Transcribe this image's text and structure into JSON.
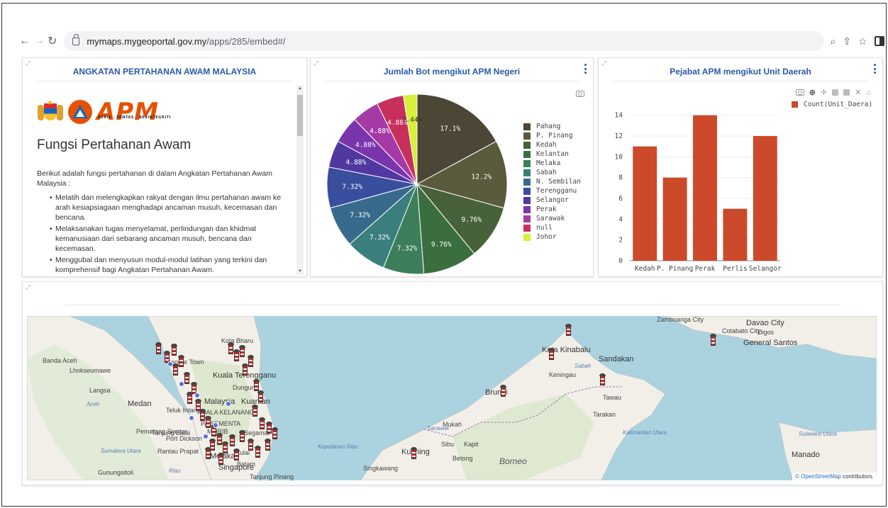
{
  "browser": {
    "url_host": "mymaps.mygeoportal.gov.my",
    "url_path": "/apps/285/embed#/"
  },
  "text_panel": {
    "title": "ANGKATAN PERTAHANAN AWAM MALAYSIA",
    "logo_word": "APM",
    "logo_tagline": "BERIA . PANTAS . BERINTEGRITI",
    "heading": "Fungsi Pertahanan Awam",
    "intro": "Berikut adalah fungsi pertahanan di dalam Angkatan Pertahanan Awam Malaysia :",
    "bullets": [
      "Melatih dan melengkapkan rakyat dengan ilmu pertahanan awam ke arah kesiapsiagaan menghadapi ancaman musuh, kecemasan dan bencana.",
      "Melaksanakan tugas menyelamat, perlindungan dan khidmat kemanusiaan dari sebarang ancaman musuh, bencana dan kecemasan.",
      "Menggubal dan menyusun modul-modul latihan yang terkini dan komprehensif bagi Angkatan Pertahanan Awam."
    ]
  },
  "pie_panel": {
    "title": "Jumlah Bot mengikut APM Negeri"
  },
  "bar_panel": {
    "title": "Pejabat APM mengikut Unit Daerah"
  },
  "map_panel": {
    "attribution_link": "© OpenStreetMap",
    "attribution_rest": " contributors.",
    "labels": [
      {
        "t": "Banda Aceh",
        "c": ""
      },
      {
        "t": "Lhokseumawe",
        "c": ""
      },
      {
        "t": "Langsa",
        "c": ""
      },
      {
        "t": "Medan",
        "c": "big"
      },
      {
        "t": "Pematang Siantar",
        "c": ""
      },
      {
        "t": "Rantau Prapat",
        "c": ""
      },
      {
        "t": "Gunungsitoli",
        "c": ""
      },
      {
        "t": "Kuala Terengganu",
        "c": "big"
      },
      {
        "t": "Dungun",
        "c": ""
      },
      {
        "t": "Malaysia",
        "c": "big"
      },
      {
        "t": "Kuantan",
        "c": "big"
      },
      {
        "t": "Segamat",
        "c": ""
      },
      {
        "t": "Melaka",
        "c": "big"
      },
      {
        "t": "Singapore",
        "c": "big"
      },
      {
        "t": "Kota Kinabalu",
        "c": "big"
      },
      {
        "t": "Sandakan",
        "c": "big"
      },
      {
        "t": "Keningau",
        "c": ""
      },
      {
        "t": "Tawau",
        "c": ""
      },
      {
        "t": "Tarakan",
        "c": ""
      },
      {
        "t": "Brunei",
        "c": "big"
      },
      {
        "t": "Mukah",
        "c": ""
      },
      {
        "t": "Sibu",
        "c": ""
      },
      {
        "t": "Kapit",
        "c": ""
      },
      {
        "t": "Kuching",
        "c": "big"
      },
      {
        "t": "Betong",
        "c": ""
      },
      {
        "t": "Singkawang",
        "c": ""
      },
      {
        "t": "Borneo",
        "c": "brn"
      },
      {
        "t": "Zamboanga City",
        "c": ""
      },
      {
        "t": "Davao City",
        "c": "big"
      },
      {
        "t": "General Santos",
        "c": "big"
      },
      {
        "t": "Cotabato City",
        "c": ""
      },
      {
        "t": "Manado",
        "c": "big"
      },
      {
        "t": "Kalimantan Utara",
        "c": "blue"
      },
      {
        "t": "Sulawesi Utara",
        "c": "blue"
      },
      {
        "t": "Kepulauan Riau",
        "c": "blue"
      },
      {
        "t": "Sarawak",
        "c": "blue"
      },
      {
        "t": "Sabah",
        "c": "blue"
      },
      {
        "t": "Aceh",
        "c": "blue"
      },
      {
        "t": "Sumatera Utara",
        "c": "blue"
      },
      {
        "t": "Riau",
        "c": "blue"
      },
      {
        "t": "Tanjung Pinang",
        "c": ""
      },
      {
        "t": "Kota Bharu",
        "c": ""
      },
      {
        "t": "George Town",
        "c": ""
      },
      {
        "t": "Teluk Intan",
        "c": ""
      },
      {
        "t": "Tanjung Balai",
        "c": ""
      },
      {
        "t": "Port Dickson",
        "c": ""
      },
      {
        "t": "Kulai",
        "c": ""
      },
      {
        "t": "Batam",
        "c": ""
      },
      {
        "t": "Digos",
        "c": ""
      },
      {
        "t": "KUALA KELANANG",
        "c": ""
      },
      {
        "t": "PA SEMENTA",
        "c": ""
      },
      {
        "t": "MORIB",
        "c": ""
      }
    ]
  },
  "chart_data": [
    {
      "type": "pie",
      "title": "Jumlah Bot mengikut APM Negeri",
      "categories": [
        "Pahang",
        "P. Pinang",
        "Kedah",
        "Kelantan",
        "Melaka",
        "Sabah",
        "N. Sembilan",
        "Terengganu",
        "Selangor",
        "Perak",
        "Sarawak",
        "null",
        "Johor"
      ],
      "values": [
        17.1,
        12.2,
        9.76,
        9.76,
        7.32,
        7.32,
        7.32,
        7.32,
        4.88,
        4.88,
        4.88,
        4.88,
        2.44
      ],
      "colors": [
        "#4c4636",
        "#5a5a3c",
        "#47613a",
        "#3a6e3e",
        "#3d7e5a",
        "#3a7f7d",
        "#386a8c",
        "#3a4e9e",
        "#5038a0",
        "#7a35ad",
        "#a53aa5",
        "#c8305c",
        "#d7f03a"
      ],
      "legend": "right"
    },
    {
      "type": "bar",
      "title": "Pejabat APM mengikut Unit Daerah",
      "categories": [
        "Kedah",
        "P. Pinang",
        "Perak",
        "Perlis",
        "Selangor"
      ],
      "series": [
        {
          "name": "Count(Unit_Daera)",
          "values": [
            11,
            8,
            14,
            5,
            12
          ]
        }
      ],
      "ylim": [
        0,
        15
      ],
      "yticks": [
        0,
        2,
        4,
        6,
        8,
        10,
        12,
        14
      ],
      "color": "#cc4a29",
      "grid": true,
      "legend": "top-right"
    }
  ]
}
